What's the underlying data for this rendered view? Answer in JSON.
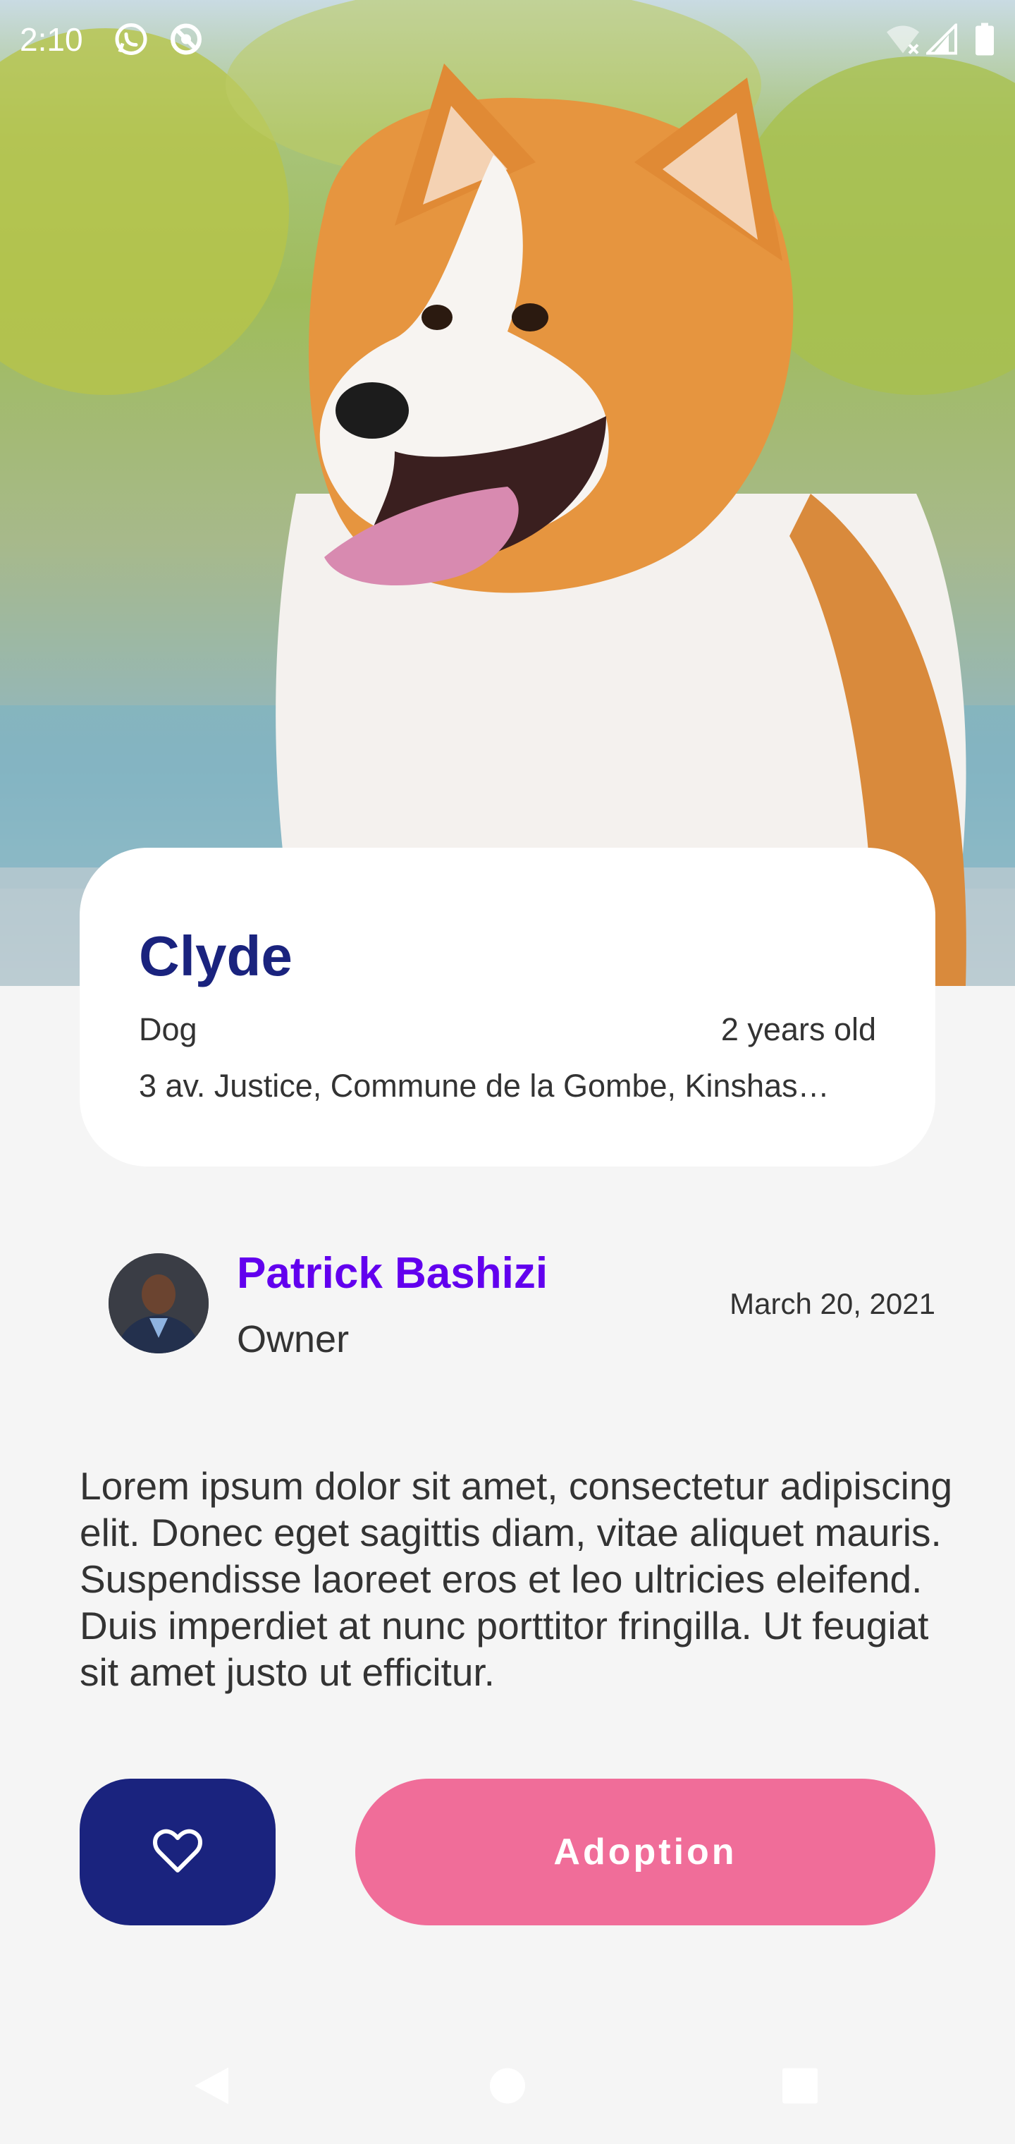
{
  "status_bar": {
    "time": "2:10",
    "icons": [
      "whatsapp-icon",
      "sync-off-icon",
      "wifi-off-icon",
      "cell-signal-icon",
      "battery-icon"
    ]
  },
  "pet": {
    "name": "Clyde",
    "species": "Dog",
    "age": "2 years old",
    "address": "3 av. Justice, Commune de la Gombe, Kinshas…"
  },
  "owner": {
    "name": "Patrick Bashizi",
    "role": "Owner",
    "date": "March 20, 2021"
  },
  "description": "Lorem ipsum dolor sit amet, consectetur adipiscing elit. Donec eget sagittis diam, vitae aliquet mauris. Suspendisse laoreet eros et leo ultricies eleifend. Duis imperdiet at nunc porttitor fringilla. Ut feugiat sit amet justo ut efficitur.",
  "actions": {
    "favorite_icon": "heart-outline-icon",
    "adopt_label": "Adoption"
  },
  "colors": {
    "primary_navy": "#1a237e",
    "accent_purple": "#6200ee",
    "adopt_pink": "#f06d99",
    "background": "#f5f5f5"
  },
  "nav_bar": {
    "icons": [
      "back-icon",
      "home-icon",
      "recents-icon"
    ]
  }
}
